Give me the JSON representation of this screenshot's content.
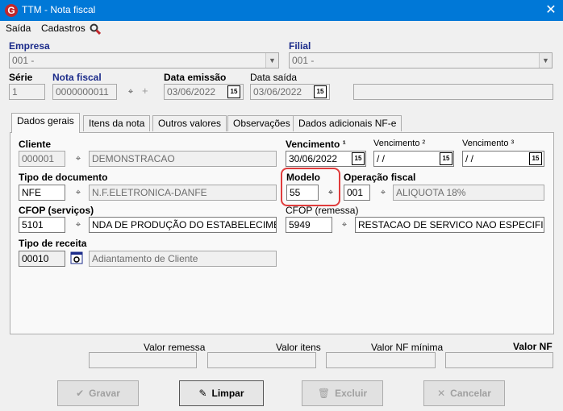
{
  "window": {
    "title": "TTM - Nota fiscal",
    "close_glyph": "✕",
    "logo_letter": "G"
  },
  "menu": {
    "items": [
      "Saída",
      "Cadastros"
    ]
  },
  "header": {
    "empresa_label": "Empresa",
    "empresa_value": "001 -",
    "filial_label": "Filial",
    "filial_value": "001 -",
    "serie_label": "Série",
    "serie_value": "1",
    "nota_fiscal_label": "Nota fiscal",
    "nota_fiscal_value": "0000000011",
    "data_emissao_label": "Data emissão",
    "data_emissao_value": "03/06/2022",
    "data_saida_label": "Data saída",
    "data_saida_value": "03/06/2022"
  },
  "tabs": [
    "Dados gerais",
    "Itens da nota",
    "Outros valores",
    "Observações",
    "Dados adicionais NF-e"
  ],
  "dados_gerais": {
    "cliente_label": "Cliente",
    "cliente_code": "000001",
    "cliente_name": "DEMONSTRACAO",
    "vencimento1_label": "Vencimento ¹",
    "vencimento1_value": "30/06/2022",
    "vencimento2_label": "Vencimento ²",
    "vencimento2_value": " / /",
    "vencimento3_label": "Vencimento ³",
    "vencimento3_value": " / /",
    "tipo_doc_label": "Tipo de documento",
    "tipo_doc_code": "NFE",
    "tipo_doc_name": "N.F.ELETRONICA-DANFE",
    "modelo_label": "Modelo",
    "modelo_value": "55",
    "operacao_label": "Operação fiscal",
    "operacao_code": "001",
    "operacao_name": "ALIQUOTA 18%",
    "cfop_serv_label": "CFOP (serviços)",
    "cfop_serv_code": "5101",
    "cfop_serv_name": "NDA DE PRODUÇÃO DO ESTABELECIMENTO",
    "cfop_rem_label": "CFOP (remessa)",
    "cfop_rem_code": "5949",
    "cfop_rem_name": "RESTACAO DE SERVICO NAO ESPECIFICADO",
    "tipo_receita_label": "Tipo de receita",
    "tipo_receita_code": "00010",
    "tipo_receita_name": "Adiantamento de Cliente"
  },
  "totals": {
    "valor_remessa_label": "Valor remessa",
    "valor_itens_label": "Valor itens",
    "valor_nf_minima_label": "Valor NF mínima",
    "valor_nf_label": "Valor NF"
  },
  "buttons": {
    "gravar": "Gravar",
    "limpar": "Limpar",
    "excluir": "Excluir",
    "cancelar": "Cancelar"
  },
  "colors": {
    "title_bar": "#0078d7",
    "label_blue": "#1b2b8a",
    "highlight": "#e03c3c"
  }
}
